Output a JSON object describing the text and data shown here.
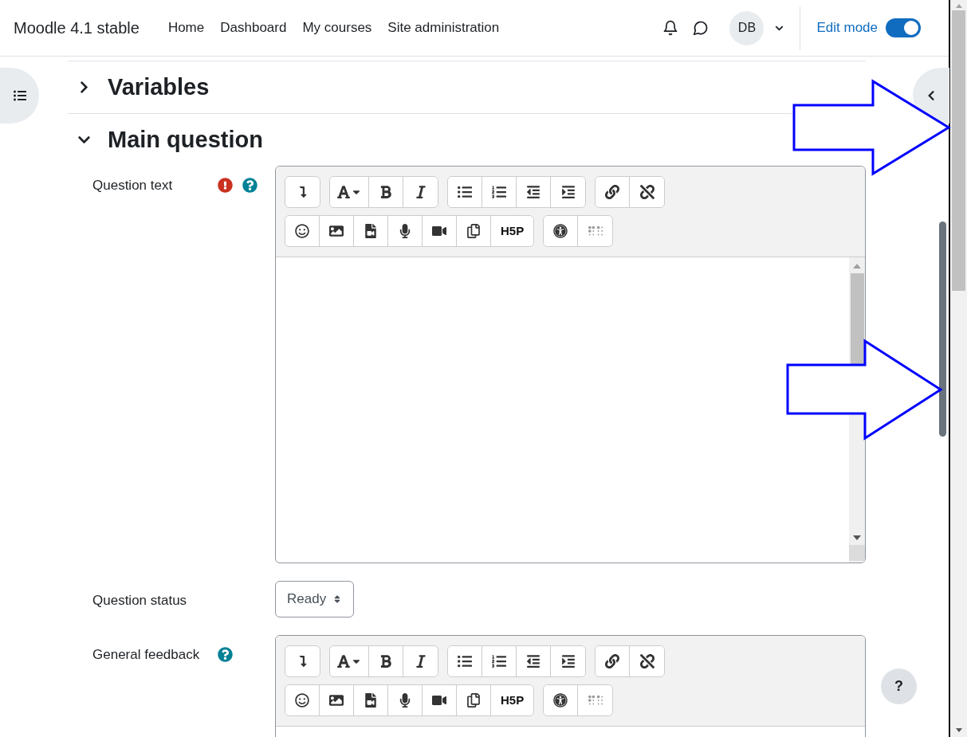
{
  "navbar": {
    "brand": "Moodle 4.1 stable",
    "links": [
      {
        "label": "Home"
      },
      {
        "label": "Dashboard"
      },
      {
        "label": "My courses"
      },
      {
        "label": "Site administration"
      }
    ],
    "avatar": "DB",
    "edit_mode": {
      "label": "Edit mode",
      "on": true
    }
  },
  "sections": [
    {
      "title": "Variables",
      "expanded": false
    },
    {
      "title": "Main question",
      "expanded": true
    }
  ],
  "fields": [
    {
      "kind": "editor",
      "label": "Question text",
      "required": true,
      "help": true,
      "toolbar_extra": "H5P"
    },
    {
      "kind": "select",
      "label": "Question status",
      "value": "Ready",
      "required": false,
      "help": false
    },
    {
      "kind": "editor",
      "label": "General feedback",
      "required": false,
      "help": true,
      "toolbar_extra": "H5P"
    }
  ],
  "help_button": "?"
}
